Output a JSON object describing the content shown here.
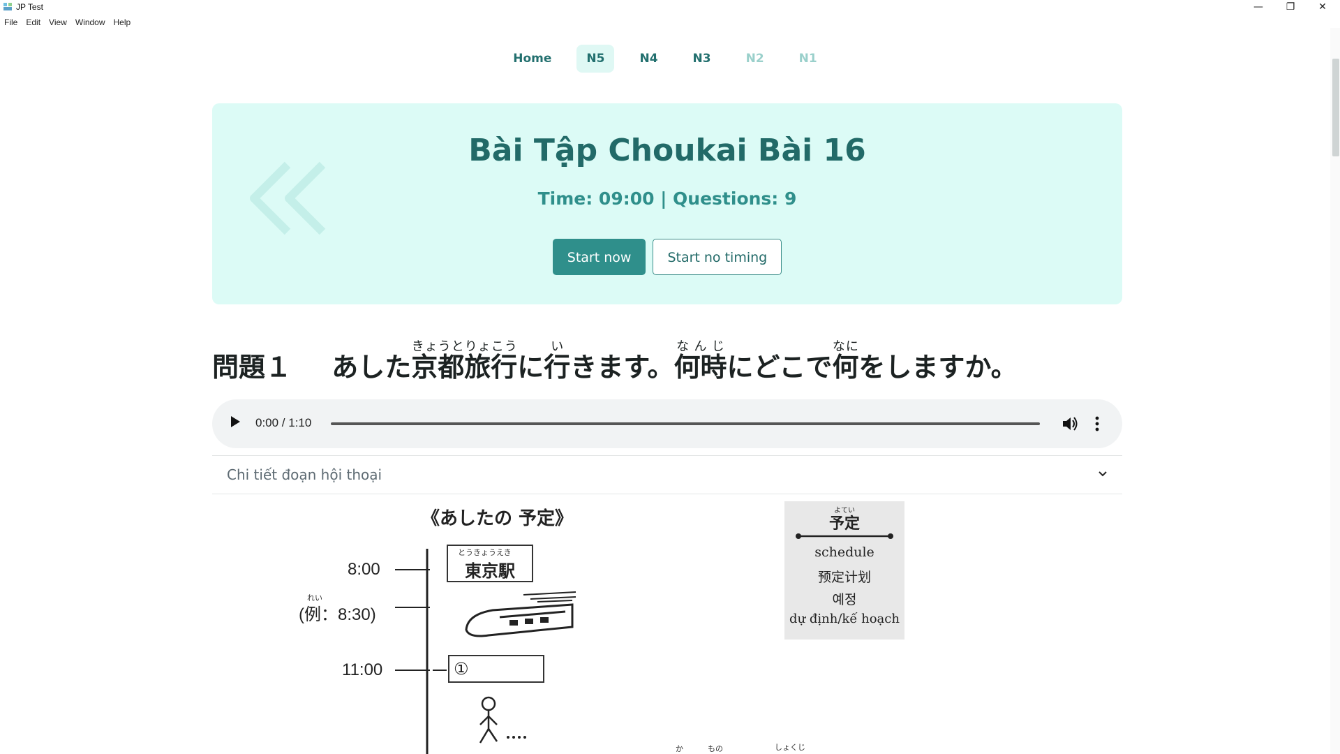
{
  "window": {
    "title": "JP Test",
    "controls": {
      "minimize": "—",
      "restore": "❐",
      "close": "✕"
    }
  },
  "menu": [
    "File",
    "Edit",
    "View",
    "Window",
    "Help"
  ],
  "nav": {
    "items": [
      {
        "label": "Home",
        "state": "normal"
      },
      {
        "label": "N5",
        "state": "active"
      },
      {
        "label": "N4",
        "state": "normal"
      },
      {
        "label": "N3",
        "state": "normal"
      },
      {
        "label": "N2",
        "state": "disabled"
      },
      {
        "label": "N1",
        "state": "disabled"
      }
    ]
  },
  "hero": {
    "title": "Bài Tập Choukai Bài 16",
    "meta": "Time: 09:00 | Questions: 9",
    "start_label": "Start now",
    "start_no_timing_label": "Start no timing"
  },
  "question": {
    "number": "問題１",
    "text_segments": [
      {
        "base": "あした"
      },
      {
        "base": "京都旅行",
        "ruby": "きょうとりょこう"
      },
      {
        "base": "に"
      },
      {
        "base": "行",
        "ruby": "い"
      },
      {
        "base": "きます。"
      },
      {
        "base": "何時",
        "ruby": "なんじ"
      },
      {
        "base": "にどこで"
      },
      {
        "base": "何",
        "ruby": "なに"
      },
      {
        "base": "をしますか。"
      }
    ]
  },
  "audio": {
    "time": "0:00 / 1:10",
    "progress": 0
  },
  "accordion": {
    "label": "Chi tiết đoạn hội thoại"
  },
  "worksheet": {
    "title": "《あしたの 予定》",
    "times": [
      "8:00",
      "(例：8:30)",
      "11:00"
    ],
    "example_ruby": "れい",
    "station_ruby": "とうきょうえき",
    "station": "東京駅",
    "box_number": "①",
    "bottom_ruby": [
      "か",
      "もの",
      "しょくじ"
    ],
    "glossary": {
      "ruby": "よてい",
      "heading": "予定",
      "lines": [
        "schedule",
        "预定计划",
        "예정",
        "dự định/kế hoạch"
      ]
    }
  },
  "colors": {
    "accent": "#2f8f8b",
    "accent_dark": "#226a68",
    "hero_bg": "#dcfbf6",
    "nav_active_bg": "#dff8f4",
    "nav_disabled": "#9ad0cb"
  }
}
